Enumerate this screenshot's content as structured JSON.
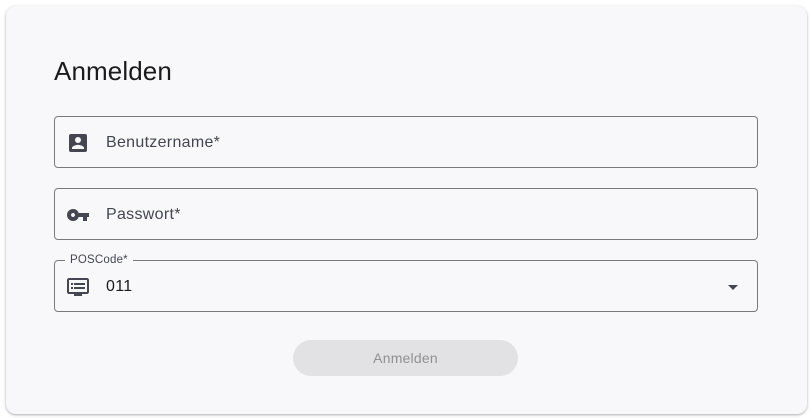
{
  "form": {
    "title": "Anmelden",
    "username": {
      "placeholder": "Benutzername*",
      "value": "",
      "icon": "account-box-icon"
    },
    "password": {
      "placeholder": "Passwort*",
      "value": "",
      "icon": "key-icon"
    },
    "poscode": {
      "label": "POSCode*",
      "value": "011",
      "icon": "point-of-sale-icon",
      "arrow": "chevron-down-icon"
    },
    "submit_label": "Anmelden",
    "submit_disabled": true
  },
  "colors": {
    "card_background": "#f8f8fa",
    "border": "#79797e",
    "text": "#1b1b1f",
    "muted_text": "#45464f",
    "button_disabled_bg": "#e2e2e5",
    "button_disabled_text": "#8f8f94"
  }
}
